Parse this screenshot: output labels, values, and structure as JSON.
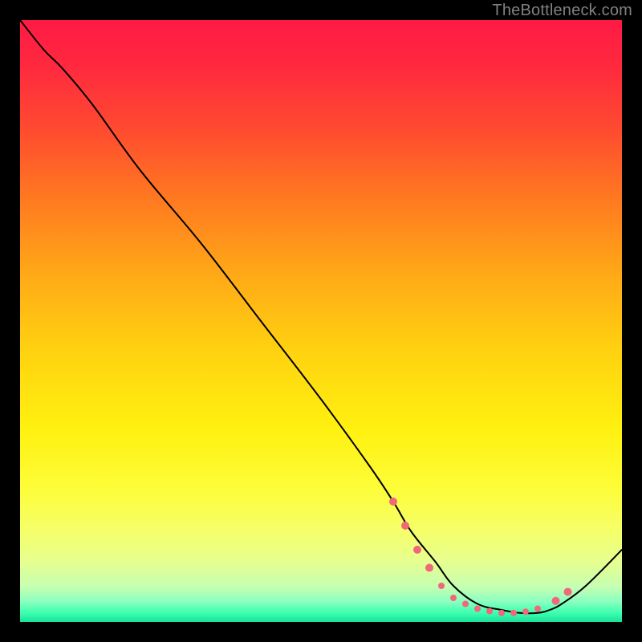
{
  "watermark": "TheBottleneck.com",
  "chart_data": {
    "type": "line",
    "title": "",
    "xlabel": "",
    "ylabel": "",
    "xlim": [
      0,
      100
    ],
    "ylim": [
      0,
      100
    ],
    "background_gradient": {
      "stops": [
        {
          "offset": 0.0,
          "color": "#ff1a45"
        },
        {
          "offset": 0.08,
          "color": "#ff2a3e"
        },
        {
          "offset": 0.18,
          "color": "#ff4a30"
        },
        {
          "offset": 0.3,
          "color": "#ff7a20"
        },
        {
          "offset": 0.42,
          "color": "#ffa817"
        },
        {
          "offset": 0.55,
          "color": "#ffd210"
        },
        {
          "offset": 0.68,
          "color": "#fff110"
        },
        {
          "offset": 0.78,
          "color": "#fdfd3a"
        },
        {
          "offset": 0.85,
          "color": "#f5ff6a"
        },
        {
          "offset": 0.9,
          "color": "#e6ff90"
        },
        {
          "offset": 0.94,
          "color": "#c8ffb0"
        },
        {
          "offset": 0.965,
          "color": "#8effc0"
        },
        {
          "offset": 0.985,
          "color": "#3effb0"
        },
        {
          "offset": 1.0,
          "color": "#18e099"
        }
      ]
    },
    "series": [
      {
        "name": "bottleneck-curve",
        "x": [
          0,
          4,
          7,
          12,
          20,
          30,
          40,
          50,
          58,
          62,
          65,
          69,
          72,
          76,
          80,
          83,
          86,
          88,
          90,
          94,
          100
        ],
        "y": [
          100,
          95,
          92,
          86,
          75,
          63,
          50,
          37,
          26,
          20,
          15,
          10,
          6,
          3,
          2,
          1.5,
          1.5,
          2,
          3,
          6,
          12
        ]
      }
    ],
    "markers": {
      "name": "highlight-points",
      "color": "#f0687a",
      "points": [
        {
          "x": 62,
          "y": 20,
          "r": 5
        },
        {
          "x": 64,
          "y": 16,
          "r": 5
        },
        {
          "x": 66,
          "y": 12,
          "r": 5
        },
        {
          "x": 68,
          "y": 9,
          "r": 5
        },
        {
          "x": 70,
          "y": 6,
          "r": 4
        },
        {
          "x": 72,
          "y": 4,
          "r": 4
        },
        {
          "x": 74,
          "y": 3,
          "r": 4
        },
        {
          "x": 76,
          "y": 2.2,
          "r": 4
        },
        {
          "x": 78,
          "y": 1.8,
          "r": 4
        },
        {
          "x": 80,
          "y": 1.5,
          "r": 4
        },
        {
          "x": 82,
          "y": 1.5,
          "r": 4
        },
        {
          "x": 84,
          "y": 1.7,
          "r": 4
        },
        {
          "x": 86,
          "y": 2.2,
          "r": 4
        },
        {
          "x": 89,
          "y": 3.5,
          "r": 5
        },
        {
          "x": 91,
          "y": 5,
          "r": 5
        }
      ]
    }
  }
}
